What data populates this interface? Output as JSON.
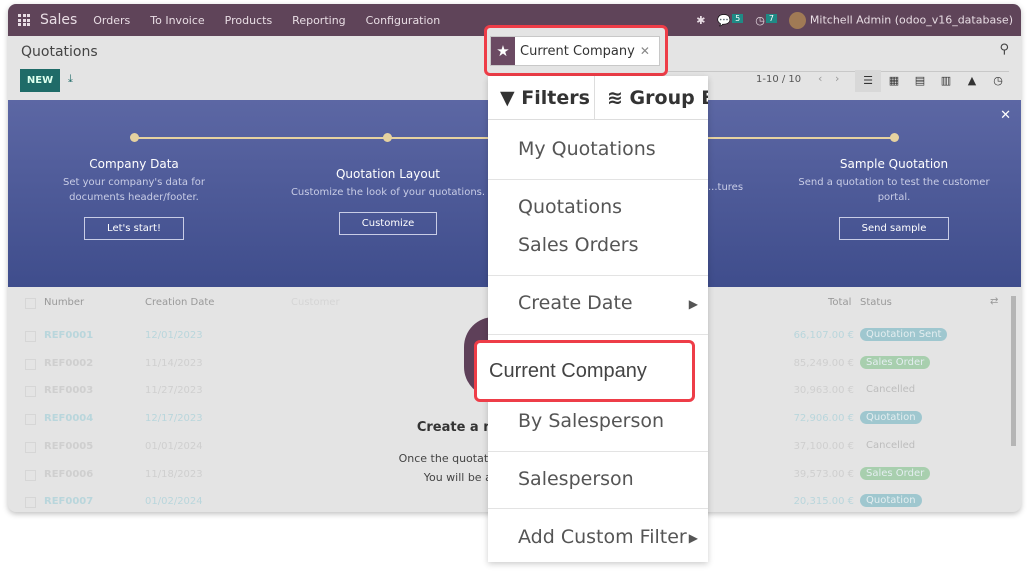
{
  "navbar": {
    "app": "Sales",
    "menu": [
      "Orders",
      "To Invoice",
      "Products",
      "Reporting",
      "Configuration"
    ],
    "messages_count": "5",
    "activities_count": "7",
    "user": "Mitchell Admin (odoo_v16_database)"
  },
  "control_panel": {
    "title": "Quotations",
    "new_label": "NEW",
    "pager": "1-10 / 10",
    "search_facet": "Current Company",
    "views": [
      "list",
      "kanban",
      "calendar",
      "pivot",
      "graph",
      "activity"
    ],
    "active_view": "list"
  },
  "banner": {
    "steps": [
      {
        "title": "Company Data",
        "text": "Set your company's data for documents header/footer.",
        "button": "Let's start!"
      },
      {
        "title": "Quotation Layout",
        "text": "Customize the look of your quotations.",
        "button": "Customize"
      },
      {
        "title": "",
        "text": "...tures",
        "button": ""
      },
      {
        "title": "Sample Quotation",
        "text": "Send a quotation to test the customer portal.",
        "button": "Send sample"
      }
    ]
  },
  "table": {
    "columns": [
      "Number",
      "Creation Date",
      "Customer",
      "Total",
      "Status"
    ],
    "rows": [
      {
        "number": "REF0001",
        "date": "12/01/2023",
        "total": "66,107.00 €",
        "status": "Quotation Sent",
        "color": "#9fc7cf"
      },
      {
        "number": "REF0002",
        "date": "11/14/2023",
        "total": "85,249.00 €",
        "status": "Sales Order",
        "color": "#a8cfae"
      },
      {
        "number": "REF0003",
        "date": "11/27/2023",
        "total": "30,963.00 €",
        "status": "Cancelled",
        "color": ""
      },
      {
        "number": "REF0004",
        "date": "12/17/2023",
        "total": "72,906.00 €",
        "status": "Quotation",
        "color": "#9fc7cf"
      },
      {
        "number": "REF0005",
        "date": "01/01/2024",
        "total": "37,100.00 €",
        "status": "Cancelled",
        "color": ""
      },
      {
        "number": "REF0006",
        "date": "11/18/2023",
        "total": "39,573.00 €",
        "status": "Sales Order",
        "color": "#a8cfae"
      },
      {
        "number": "REF0007",
        "date": "01/02/2024",
        "total": "20,315.00 €",
        "status": "Quotation",
        "color": "#9fc7cf"
      }
    ]
  },
  "empty_state": {
    "title": "Create a new quotation",
    "line1": "Once the quotation is confirmed ... er.",
    "line2": "You will be able to create a..."
  },
  "dropdown": {
    "tabs": [
      "Filters",
      "Group By"
    ],
    "items": [
      "My Quotations",
      "Quotations",
      "Sales Orders",
      "Create Date",
      "Current Company",
      "By Salesperson",
      "Salesperson",
      "Add Custom Filter"
    ],
    "highlighted": "Current Company"
  }
}
